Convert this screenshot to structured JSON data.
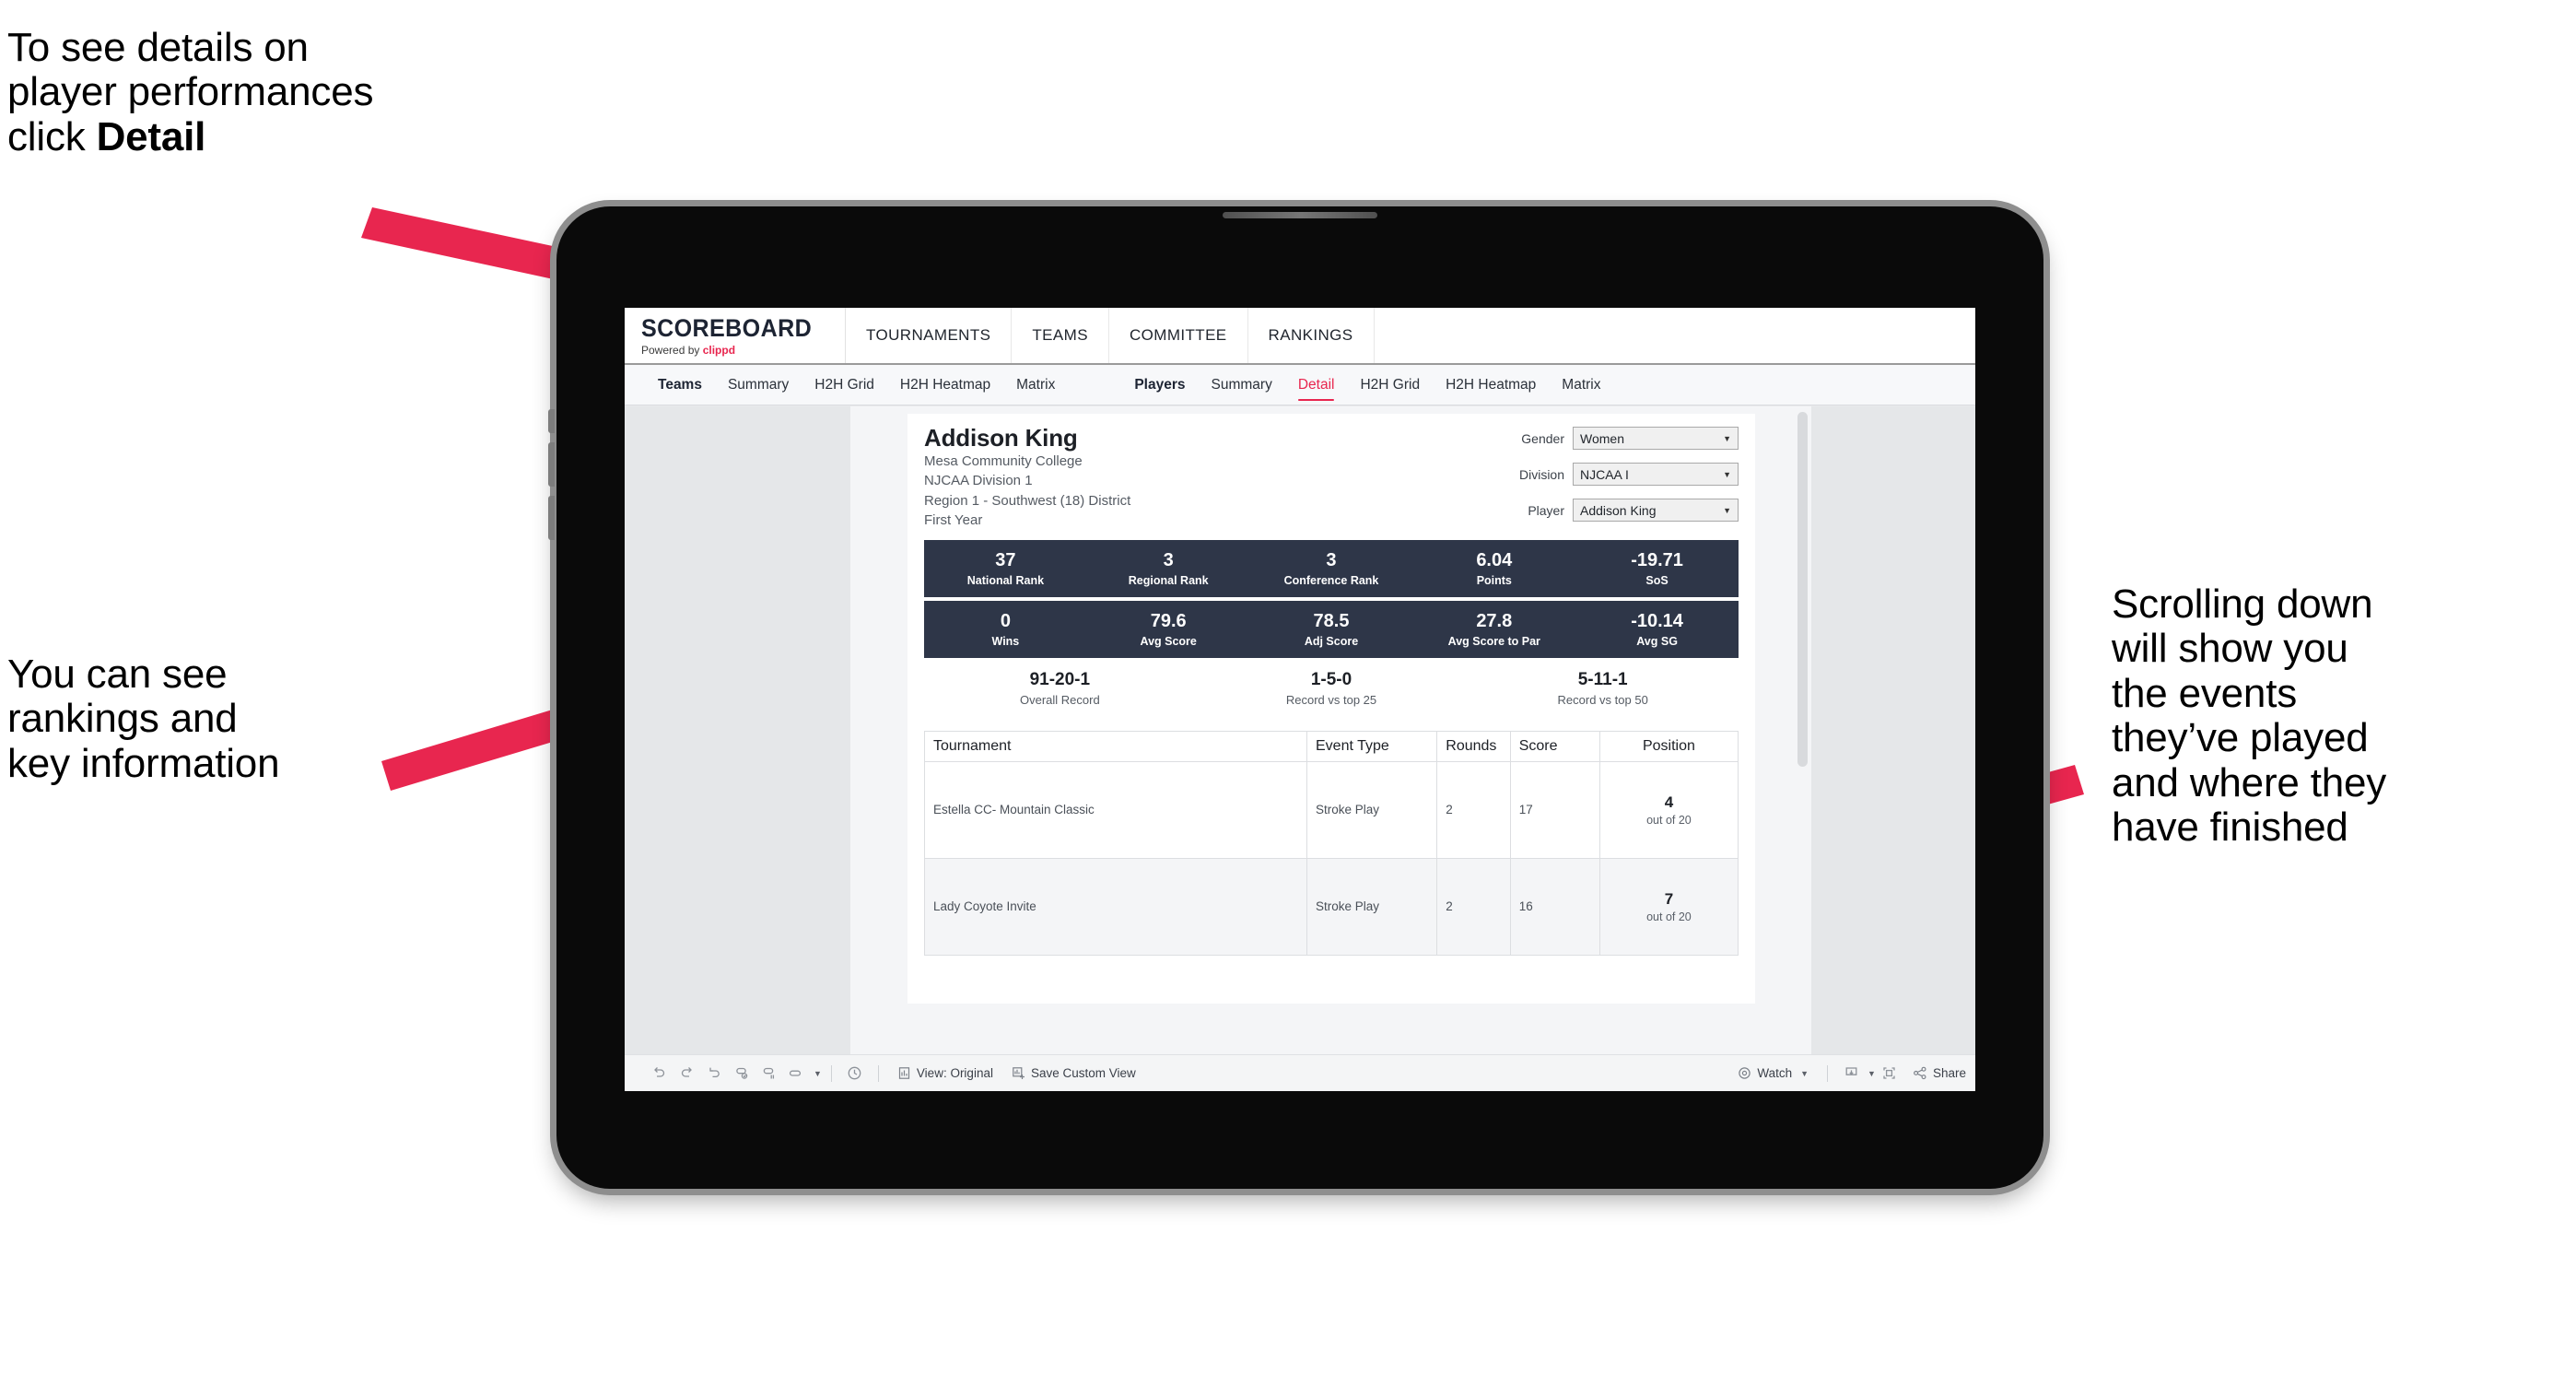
{
  "annotations": {
    "top": {
      "text_before": "To see details on\nplayer performances\nclick ",
      "bold": "Detail"
    },
    "left": {
      "text": "You can see\nrankings and\nkey information"
    },
    "right": {
      "text": "Scrolling down\nwill show you\nthe events\nthey’ve played\nand where they\nhave finished"
    }
  },
  "colors": {
    "accent": "#e8264f",
    "band": "#2e3648",
    "page_bg": "#e5e7e9"
  },
  "app": {
    "brand": {
      "name": "SCOREBOARD",
      "powered_prefix": "Powered by ",
      "powered_brand": "clippd"
    },
    "nav": [
      "TOURNAMENTS",
      "TEAMS",
      "COMMITTEE",
      "RANKINGS"
    ],
    "tabs_teams": {
      "lead": "Teams",
      "items": [
        "Summary",
        "H2H Grid",
        "H2H Heatmap",
        "Matrix"
      ]
    },
    "tabs_players": {
      "lead": "Players",
      "items": [
        "Summary",
        "Detail",
        "H2H Grid",
        "H2H Heatmap",
        "Matrix"
      ],
      "active": "Detail"
    }
  },
  "player": {
    "name": "Addison King",
    "lines": [
      "Mesa Community College",
      "NJCAA Division 1",
      "Region 1 - Southwest (18) District",
      "First Year"
    ],
    "filters": [
      {
        "label": "Gender",
        "value": "Women"
      },
      {
        "label": "Division",
        "value": "NJCAA I"
      },
      {
        "label": "Player",
        "value": "Addison King"
      }
    ]
  },
  "stats_row1": [
    {
      "value": "37",
      "label": "National Rank"
    },
    {
      "value": "3",
      "label": "Regional Rank"
    },
    {
      "value": "3",
      "label": "Conference Rank"
    },
    {
      "value": "6.04",
      "label": "Points"
    },
    {
      "value": "-19.71",
      "label": "SoS"
    }
  ],
  "stats_row2": [
    {
      "value": "0",
      "label": "Wins"
    },
    {
      "value": "79.6",
      "label": "Avg Score"
    },
    {
      "value": "78.5",
      "label": "Adj Score"
    },
    {
      "value": "27.8",
      "label": "Avg Score to Par"
    },
    {
      "value": "-10.14",
      "label": "Avg SG"
    }
  ],
  "records": [
    {
      "value": "91-20-1",
      "label": "Overall Record"
    },
    {
      "value": "1-5-0",
      "label": "Record vs top 25"
    },
    {
      "value": "5-11-1",
      "label": "Record vs top 50"
    }
  ],
  "table": {
    "headers": [
      "Tournament",
      "Event Type",
      "Rounds",
      "Score",
      "Position"
    ],
    "rows": [
      {
        "tournament": "Estella CC- Mountain Classic",
        "event_type": "Stroke Play",
        "rounds": "2",
        "score": "17",
        "position": "4",
        "position_out_of": "out of 20"
      },
      {
        "tournament": "Lady Coyote Invite",
        "event_type": "Stroke Play",
        "rounds": "2",
        "score": "16",
        "position": "7",
        "position_out_of": "out of 20"
      }
    ]
  },
  "toolbar": {
    "icons": [
      "undo-icon",
      "redo-icon",
      "revert-icon",
      "refresh-icon",
      "pause-icon",
      "zoom-icon",
      "clock-icon"
    ],
    "view": "View: Original",
    "save_view": "Save Custom View",
    "watch": "Watch",
    "share": "Share"
  }
}
